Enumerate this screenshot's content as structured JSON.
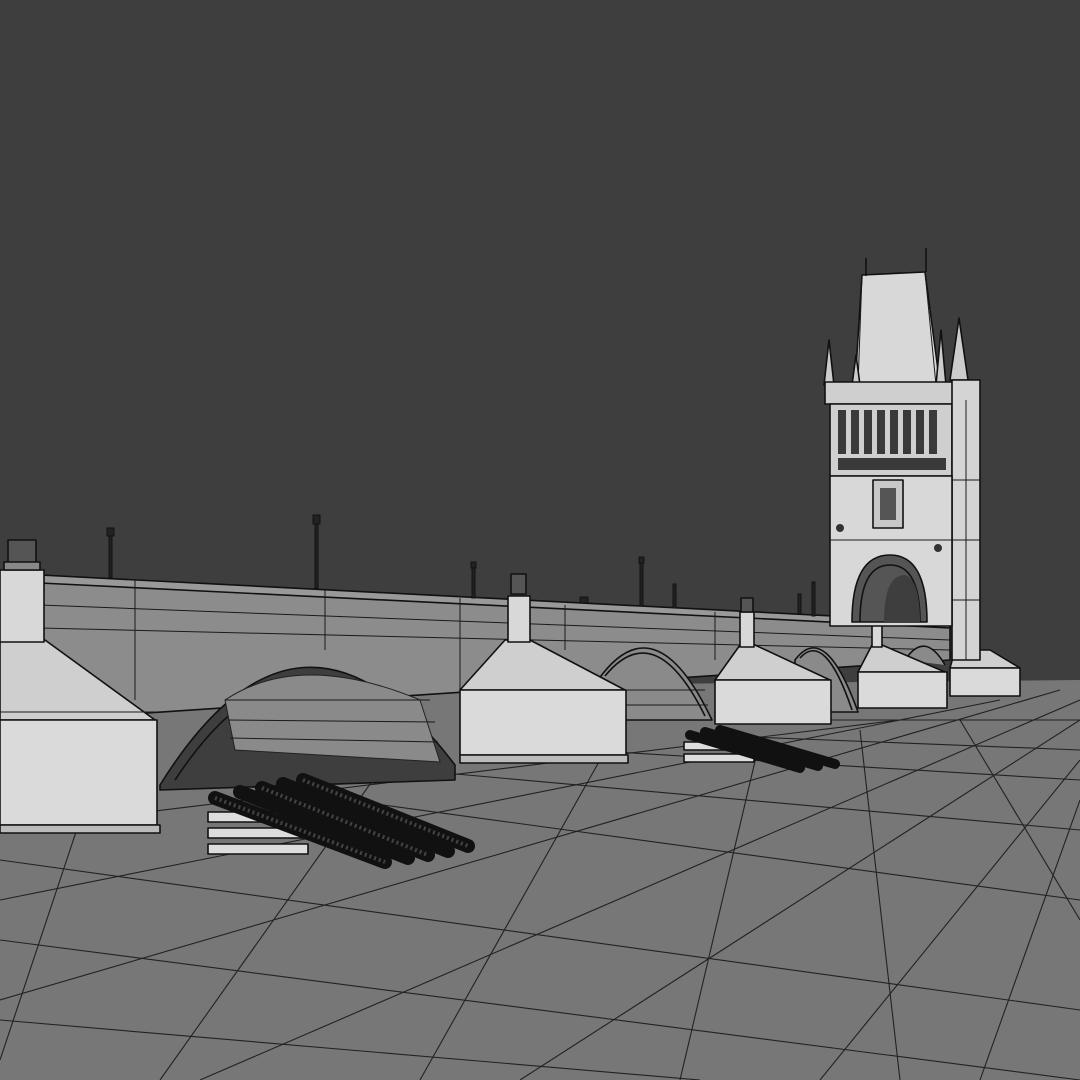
{
  "scene": {
    "name": "3d-bridge-render",
    "colors": {
      "sky": "#3e3e3e",
      "ground": "#7a7a7a",
      "ground_dark": "#6a6a6a",
      "wall": "#8e8e8e",
      "pier_light": "#cfcfcf",
      "pier_face": "#dcdcdc",
      "tower": "#d6d6d6",
      "outline": "#111111"
    }
  }
}
